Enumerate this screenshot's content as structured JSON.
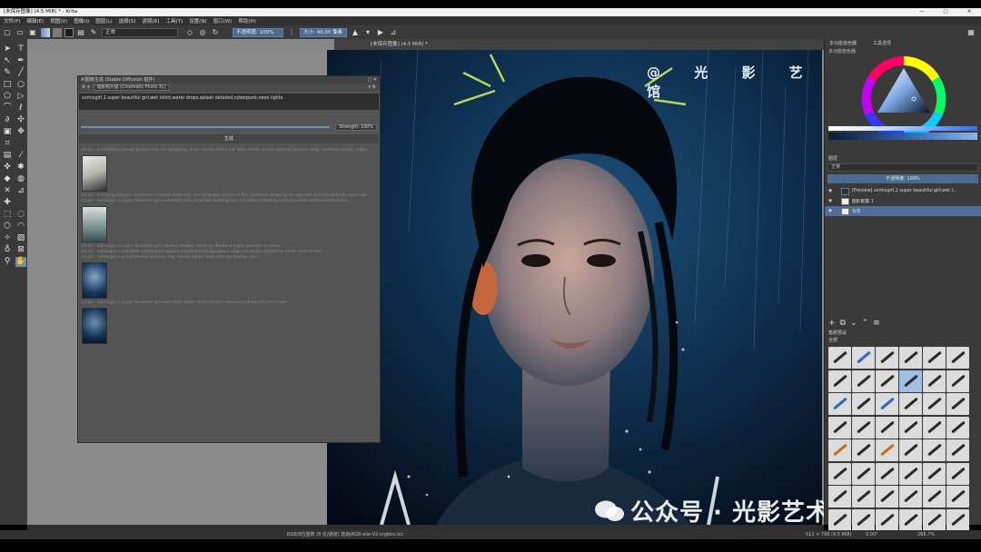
{
  "window": {
    "title": "[未保存图像] (4.5 MiB) * - Krita",
    "controls": [
      "—",
      "▢",
      "✕"
    ]
  },
  "menu": [
    "文件(F)",
    "编辑(E)",
    "视图(V)",
    "图像(I)",
    "图层(L)",
    "选择(S)",
    "滤镜(R)",
    "工具(T)",
    "设置(N)",
    "窗口(W)",
    "帮助(H)"
  ],
  "toolbar": {
    "blend_mode": "正常",
    "opacity_label": "不透明度: 100%",
    "size_label": "大小: 40.00 像素"
  },
  "document_tab": "[未保存图像] (4.5 MiB) *",
  "plugin": {
    "title": "AI图像生成 (Stable Diffusion 插件)",
    "model": "电影照片级 (Cinematic Photo XL)",
    "prompt": "xxmixgirl,1 super beautiful girl,wet tshirt,water drops,splash detailed,cyberpunk,neon lights.",
    "strength": "Strength: 100%",
    "generate": "生成",
    "history": [
      "16:03 - a beautiful young woman like Fan Bingbing, wear shorts and a hat walk street, in the style of cartoon lang, candid pictures, captu...",
      "15:03 - a mixing woman in ancient Chinese costume, hair braided, smiles at the audience wearing an intricate and translucent linen fab...",
      "15:29 - xxmixgirl,1 super beautiful girl,wet,black hair,long hair,floating hair,full body,standing,outdoors,wet clothes,water,wave...",
      "15:25 - xxmixgirl,1 super beautiful girl,colorful feather dress by Maxwell Irajes Hanami Hinoma...",
      "15:21 - xxmixgirl,1c(8k,RAW photo,best quality,masterpiece),gorgeous long hair,drops,splashing water,neutral dec...",
      "15:20 - xxmixgirl,1 a mysterious woman, fog, movie lights, blue and red theme, rain...",
      "15:48 - xxmixgirl,1 super beautiful girl,wet tshirt,water drops,splash detailed,cyberpunk,neon light."
    ]
  },
  "watermark": {
    "top": "@ 光 影 艺 术 生 活 馆",
    "bottom": "公众号 · 光影艺术生活馆"
  },
  "dock": {
    "tabs": [
      "多功能拾色器",
      "工具选项"
    ],
    "selector_label": "多功能拾色器",
    "layers_title": "图层",
    "layers_blend": "正常",
    "layers_opacity": "不透明度: 100%",
    "layers": [
      {
        "name": "[Preview] xxmixgirl,1 super beautiful girl,wet t...",
        "selected": false
      },
      {
        "name": "图形配置 1",
        "selected": false
      },
      {
        "name": "背景",
        "selected": true
      }
    ],
    "brush_title": "笔刷预设",
    "brush_filter": "全部"
  },
  "status": {
    "left1": "RGB/8位整数 (8 位/通道) 选定",
    "left2": "sRGB-elle-V2-srgbtrc.icc",
    "right1": "512 × 768 (4.5 MiB)",
    "right2": "0.00°",
    "right3": "266.7%"
  },
  "colors": {
    "accent": "#4d6f99",
    "ui_bg": "#3a3a3a",
    "canvas_bg": "#878787"
  }
}
